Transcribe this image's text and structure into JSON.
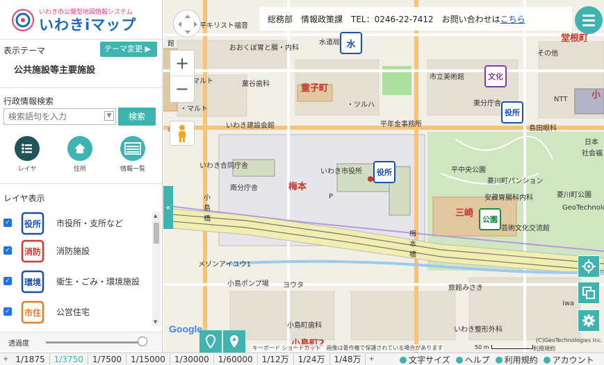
{
  "app": {
    "logo_subtitle": "いわき市公開型地図情報システム",
    "logo_title": "いわきiマップ"
  },
  "sidebar": {
    "theme_label": "表示テーマ",
    "theme_change_button": "テーマ変更 ▶",
    "theme_name": "公共施設等主要施設",
    "search_label": "行政情報検索",
    "search_placeholder": "検索語句を入力",
    "search_button": "検索",
    "nav": [
      {
        "label": "レイヤ",
        "icon": "layers-icon"
      },
      {
        "label": "住所",
        "icon": "home-icon"
      },
      {
        "label": "情報一覧",
        "icon": "list-icon"
      }
    ],
    "layer_heading": "レイヤ表示",
    "layers": [
      {
        "label": "市役所・支所など",
        "icon_text": "役所",
        "color": "#1a4fb5",
        "checked": true
      },
      {
        "label": "消防施設",
        "icon_text": "消防",
        "color": "#d9342b",
        "checked": true
      },
      {
        "label": "衛生・ごみ・環境施設",
        "icon_text": "環境",
        "color": "#1a4fb5",
        "checked": true
      },
      {
        "label": "公営住宅",
        "icon_text": "市住",
        "color": "#e07b2a",
        "checked": true
      }
    ],
    "opacity_label": "透過度",
    "opacity_value": 1.0
  },
  "header": {
    "text": "総務部　情報政策課　TEL：0246-22-7412　お問い合わせは",
    "link": "こちら"
  },
  "map": {
    "labels": {
      "l1": "平キリスト福音",
      "l2": "おおくぼ胃と腸・内科",
      "l3": "水道局",
      "l4": "りのマルト",
      "l5": "菓谷歯科",
      "l6": "童子町",
      "l7": "市立美術館",
      "l8": "東分庁舎",
      "l9": "NTT",
      "l10": "・ツルハ",
      "l11": "・マルト",
      "l12": "いわき建設会館",
      "l13": "平年金事務所",
      "l14": "島田眼科",
      "l15": "いわき合同庁舎",
      "l16": "いわき市役所",
      "l17": "南分庁舎",
      "l18": "梅本",
      "l19": "平中央公園",
      "l20": "菱川町パンション",
      "l21": "安藏胃腸科内科",
      "l22": "菱川町公園",
      "l23": "三崎",
      "l24": "芸術文化交流館",
      "l25": "小島橋",
      "l26": "梅本橋",
      "l27": "メゾンアイユウ1",
      "l28": "小島ポンプ場",
      "l29": "ヨウタ",
      "l30": "旅館みさき",
      "l31": "小島町歯科",
      "l32": "いわき整形外科",
      "l33": "小島町2",
      "l34": "堂根町",
      "l35": "日本",
      "l36": "社会福",
      "l37": "P",
      "l38": "小",
      "l39": "その他",
      "l40": "iwa",
      "l41": "GeoTechnologies Inc.",
      "l42": "平",
      "l43": "館"
    },
    "markers": {
      "water": "水",
      "city_hall": "役所",
      "culture": "文化",
      "east_office": "役所",
      "park": "公園",
      "other": "その他"
    },
    "google": "Google",
    "attribution": "キーボード ショートカット　画像は著作権で保護されている場合があります",
    "scale": "50 m",
    "copyright": "(C)GeoTechnologies Inc.",
    "usage": "利用規約"
  },
  "bottombar": {
    "scales": [
      "1/1875",
      "1/3750",
      "1/7500",
      "1/15000",
      "1/30000",
      "1/60000",
      "1/12万",
      "1/24万",
      "1/48万"
    ],
    "active_scale": "1/3750",
    "links": {
      "font_size": "文字サイズ",
      "help": "ヘルプ",
      "terms": "利用規約",
      "account": "アカウント"
    }
  }
}
